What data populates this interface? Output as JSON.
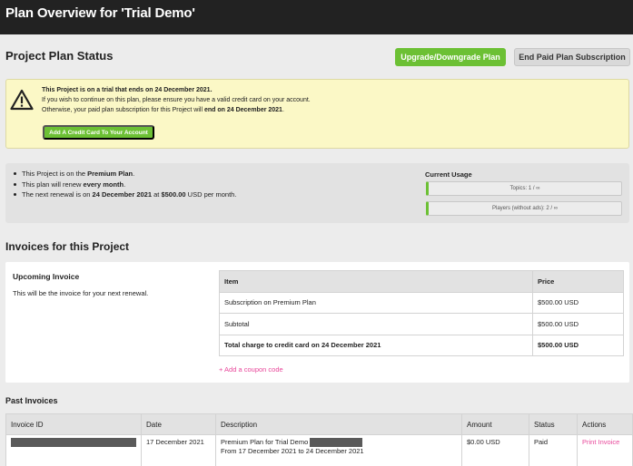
{
  "page": {
    "title": "Plan Overview for 'Trial Demo'"
  },
  "status": {
    "title": "Project Plan Status",
    "upgrade_label": "Upgrade/Downgrade Plan",
    "end_label": "End Paid Plan Subscription"
  },
  "alert": {
    "line1": "This Project is on a trial that ends on 24 December 2021.",
    "line2": "If you wish to continue on this plan, please ensure you have a valid credit card on your account.",
    "line3_pre": "Otherwise, your paid plan subscription for this Project will ",
    "line3_bold": "end on 24 December 2021",
    "line3_post": ".",
    "button_label": "Add A Credit Card To Your Account"
  },
  "plan": {
    "item1_pre": "This Project is on the ",
    "item1_bold": "Premium Plan",
    "item1_post": ".",
    "item2_pre": "This plan will renew ",
    "item2_bold": "every month",
    "item2_post": ".",
    "item3_pre": "The next renewal is on ",
    "item3_bold": "24 December 2021",
    "item3_mid": " at ",
    "item3_bold2": "$500.00",
    "item3_post": " USD per month."
  },
  "usage": {
    "title": "Current Usage",
    "topics": "Topics: 1 / ∞",
    "players": "Players (without ads): 2 / ∞"
  },
  "invoices": {
    "title": "Invoices for this Project",
    "upcoming_title": "Upcoming Invoice",
    "upcoming_desc": "This will be the invoice for your next renewal.",
    "col_item": "Item",
    "col_price": "Price",
    "rows": [
      {
        "item": "Subscription on Premium Plan",
        "price": "$500.00 USD"
      },
      {
        "item": "Subtotal",
        "price": "$500.00 USD"
      },
      {
        "item": "Total charge to credit card on 24 December 2021",
        "price": "$500.00 USD"
      }
    ],
    "coupon_label": "+ Add a coupon code"
  },
  "past": {
    "title": "Past Invoices",
    "headers": {
      "id": "Invoice ID",
      "date": "Date",
      "description": "Description",
      "amount": "Amount",
      "status": "Status",
      "actions": "Actions"
    },
    "row": {
      "date": "17 December 2021",
      "desc_line1": "Premium Plan for Trial Demo",
      "desc_line2": "From 17 December 2021 to 24 December 2021",
      "amount": "$0.00 USD",
      "status": "Paid",
      "action": "Print Invoice"
    }
  },
  "colors": {
    "accent_green": "#6cc034",
    "link_pink": "#e8479a",
    "alert_bg": "#fbf8c6",
    "topbar": "#222222"
  }
}
